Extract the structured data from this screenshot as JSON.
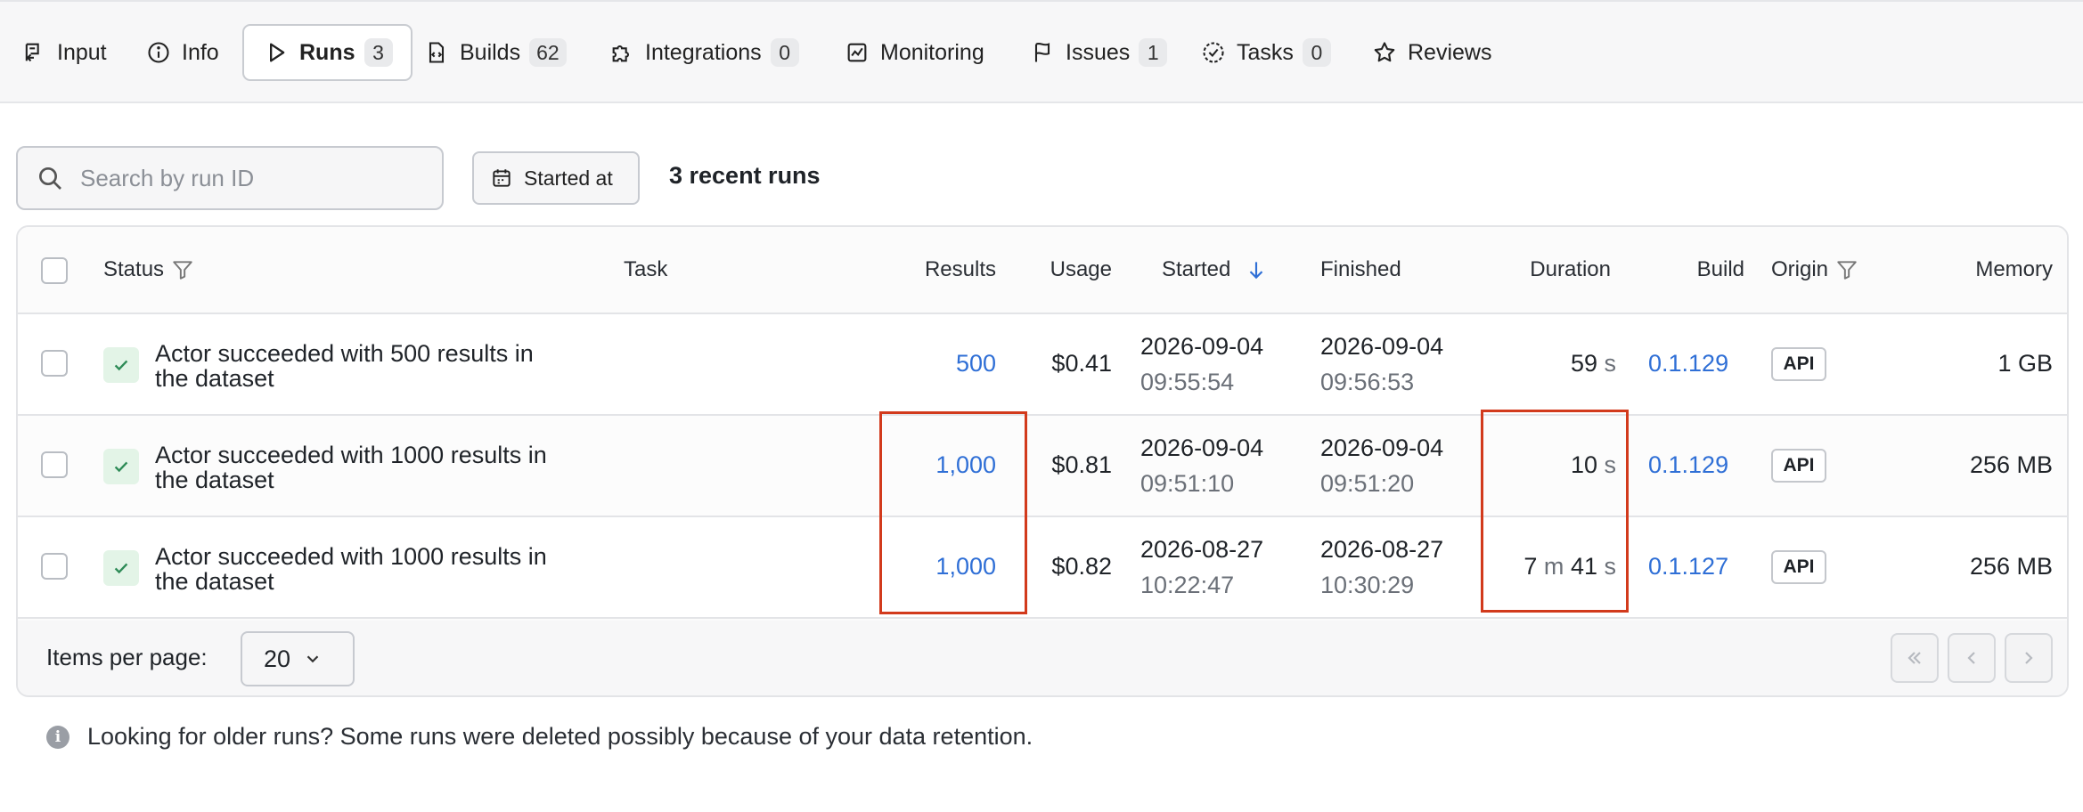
{
  "tabs": [
    {
      "label": "Input",
      "icon": "input-icon",
      "count": null
    },
    {
      "label": "Info",
      "icon": "info-icon",
      "count": null
    },
    {
      "label": "Runs",
      "icon": "play-icon",
      "count": "3",
      "active": true
    },
    {
      "label": "Builds",
      "icon": "file-code-icon",
      "count": "62"
    },
    {
      "label": "Integrations",
      "icon": "puzzle-icon",
      "count": "0"
    },
    {
      "label": "Monitoring",
      "icon": "chart-icon",
      "count": null
    },
    {
      "label": "Issues",
      "icon": "flag-icon",
      "count": "1"
    },
    {
      "label": "Tasks",
      "icon": "task-check-icon",
      "count": "0"
    },
    {
      "label": "Reviews",
      "icon": "star-icon",
      "count": null
    }
  ],
  "toolbar": {
    "search_placeholder": "Search by run ID",
    "search_value": "",
    "started_at_label": "Started at",
    "recent_runs_label": "3 recent runs"
  },
  "table": {
    "columns": {
      "status": "Status",
      "task": "Task",
      "results": "Results",
      "usage": "Usage",
      "started": "Started",
      "finished": "Finished",
      "duration": "Duration",
      "build": "Build",
      "origin": "Origin",
      "memory": "Memory"
    },
    "rows": [
      {
        "status_text_line1": "Actor succeeded with 500 results in",
        "status_text_line2": "the dataset",
        "results": "500",
        "usage": "$0.41",
        "started_date": "2026-09-04",
        "started_time": "09:55:54",
        "finished_date": "2026-09-04",
        "finished_time": "09:56:53",
        "duration_value": "59",
        "duration_unit": "s",
        "build": "0.1.129",
        "origin": "API",
        "memory": "1 GB"
      },
      {
        "status_text_line1": "Actor succeeded with 1000 results in",
        "status_text_line2": "the dataset",
        "results": "1,000",
        "usage": "$0.81",
        "started_date": "2026-09-04",
        "started_time": "09:51:10",
        "finished_date": "2026-09-04",
        "finished_time": "09:51:20",
        "duration_value": "10",
        "duration_unit": "s",
        "build": "0.1.129",
        "origin": "API",
        "memory": "256 MB"
      },
      {
        "status_text_line1": "Actor succeeded with 1000 results in",
        "status_text_line2": "the dataset",
        "results": "1,000",
        "usage": "$0.82",
        "started_date": "2026-08-27",
        "started_time": "10:22:47",
        "finished_date": "2026-08-27",
        "finished_time": "10:30:29",
        "duration_min": "7",
        "duration_min_unit": "m",
        "duration_value": "41",
        "duration_unit": "s",
        "build": "0.1.127",
        "origin": "API",
        "memory": "256 MB"
      }
    ]
  },
  "pagination": {
    "items_per_page_label": "Items per page:",
    "items_per_page_value": "20"
  },
  "footer_note": "Looking for older runs? Some runs were deleted possibly because of your data retention.",
  "colors": {
    "link": "#2f6fd6",
    "highlight": "#d23a1c",
    "success_bg": "#e3f4e7",
    "success_check": "#2e8b57"
  }
}
